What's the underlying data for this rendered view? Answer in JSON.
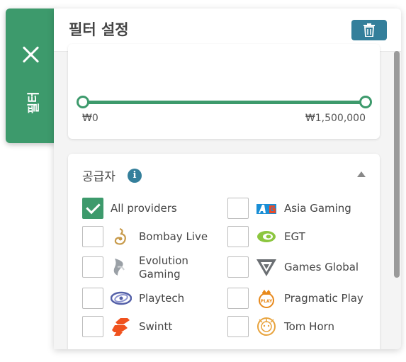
{
  "tab": {
    "label": "필터"
  },
  "panel": {
    "title": "필터 설정"
  },
  "price": {
    "min_label": "₩0",
    "max_label": "₩1,500,000",
    "min_value": 0,
    "max_value": 1500000
  },
  "providers": {
    "header": "공급자",
    "info_icon": "i",
    "items": [
      {
        "label": "All providers",
        "checked": true,
        "icon": "none"
      },
      {
        "label": "Asia Gaming",
        "checked": false,
        "icon": "asia-gaming-logo"
      },
      {
        "label": "Bombay Live",
        "checked": false,
        "icon": "bombay-live-logo"
      },
      {
        "label": "EGT",
        "checked": false,
        "icon": "egt-logo"
      },
      {
        "label": "Evolution Gaming",
        "checked": false,
        "icon": "evolution-gaming-logo"
      },
      {
        "label": "Games Global",
        "checked": false,
        "icon": "games-global-logo"
      },
      {
        "label": "Playtech",
        "checked": false,
        "icon": "playtech-logo"
      },
      {
        "label": "Pragmatic Play",
        "checked": false,
        "icon": "pragmatic-play-logo"
      },
      {
        "label": "Swintt",
        "checked": false,
        "icon": "swintt-logo"
      },
      {
        "label": "Tom Horn",
        "checked": false,
        "icon": "tom-horn-logo"
      }
    ]
  },
  "colors": {
    "accent_green": "#3d9a6c",
    "accent_blue": "#347f9b"
  }
}
